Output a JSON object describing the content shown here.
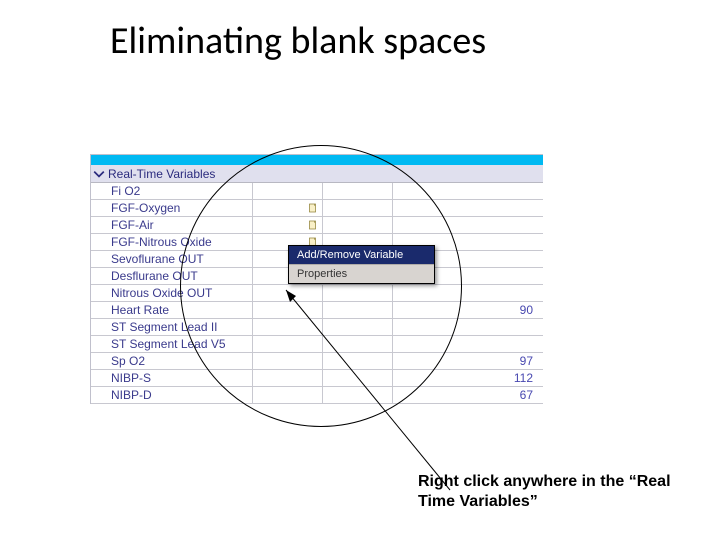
{
  "slide": {
    "title": "Eliminating blank spaces"
  },
  "section": {
    "header": "Real-Time Variables"
  },
  "rows": [
    {
      "label": "Fi O2",
      "doc": false,
      "val": ""
    },
    {
      "label": "FGF-Oxygen",
      "doc": true,
      "val": ""
    },
    {
      "label": "FGF-Air",
      "doc": true,
      "val": ""
    },
    {
      "label": "FGF-Nitrous Oxide",
      "doc": true,
      "val": ""
    },
    {
      "label": "Sevoflurane OUT",
      "doc": false,
      "val": ""
    },
    {
      "label": "Desflurane OUT",
      "doc": false,
      "val": ""
    },
    {
      "label": "Nitrous Oxide OUT",
      "doc": false,
      "val": ""
    },
    {
      "label": "Heart Rate",
      "doc": false,
      "val": "90"
    },
    {
      "label": "ST Segment Lead II",
      "doc": false,
      "val": ""
    },
    {
      "label": "ST Segment Lead V5",
      "doc": false,
      "val": ""
    },
    {
      "label": "Sp O2",
      "doc": false,
      "val": "97"
    },
    {
      "label": "NIBP-S",
      "doc": false,
      "val": "112"
    },
    {
      "label": "NIBP-D",
      "doc": false,
      "val": "67"
    }
  ],
  "context_menu": {
    "add_remove": "Add/Remove Variable",
    "properties": "Properties"
  },
  "caption": "Right click anywhere in the “Real Time Variables”"
}
